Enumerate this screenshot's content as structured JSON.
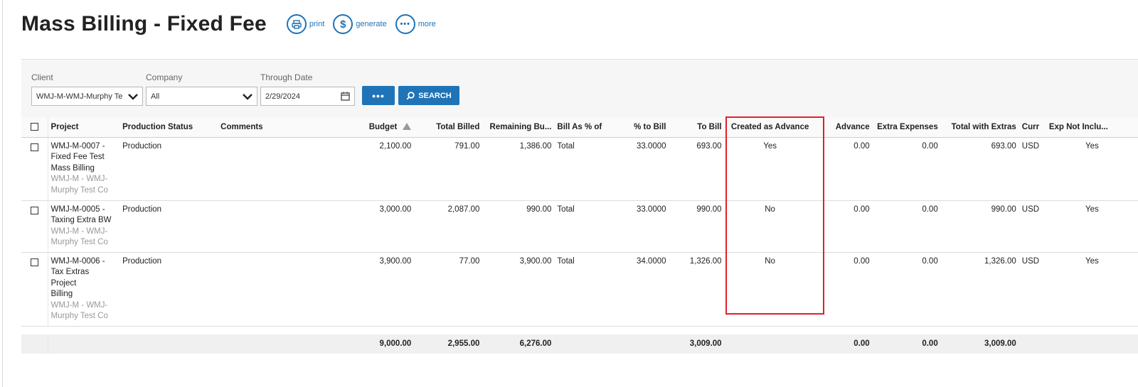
{
  "page": {
    "title": "Mass Billing - Fixed Fee",
    "actions": [
      {
        "label": "print",
        "icon": "printer-icon"
      },
      {
        "label": "generate",
        "icon": "dollar-icon"
      },
      {
        "label": "more",
        "icon": "more-dots-icon"
      }
    ]
  },
  "filters": {
    "client": {
      "label": "Client",
      "value": "WMJ-M-WMJ-Murphy Te"
    },
    "company": {
      "label": "Company",
      "value": "All"
    },
    "through_date": {
      "label": "Through Date",
      "value": "2/29/2024"
    },
    "more_button": "•••",
    "search_button": "SEARCH"
  },
  "table": {
    "headers": {
      "project": "Project",
      "production_status": "Production Status",
      "comments": "Comments",
      "budget": "Budget",
      "total_billed": "Total Billed",
      "remaining_budget": "Remaining Bu...",
      "bill_as": "Bill As % of",
      "pct_to_bill": "% to Bill",
      "to_bill": "To Bill",
      "created_as_advance": "Created as Advance",
      "advance": "Advance",
      "extra_expenses": "Extra Expenses",
      "total_with_extras": "Total with Extras",
      "curr": "Curr",
      "exp_not_included": "Exp Not Inclu..."
    },
    "rows": [
      {
        "project_lines": [
          "WMJ-M-0007 -",
          "Fixed Fee Test",
          "Mass Billing"
        ],
        "client_lines": [
          "WMJ-M - WMJ-",
          "Murphy Test Co"
        ],
        "production_status": "Production",
        "comments": "",
        "budget": "2,100.00",
        "total_billed": "791.00",
        "remaining_budget": "1,386.00",
        "bill_as": "Total",
        "pct_to_bill": "33.0000",
        "to_bill": "693.00",
        "created_as_advance": "Yes",
        "advance": "0.00",
        "extra_expenses": "0.00",
        "total_with_extras": "693.00",
        "curr": "USD",
        "exp_not_included": "Yes"
      },
      {
        "project_lines": [
          "WMJ-M-0005 -",
          "Taxing Extra BW"
        ],
        "client_lines": [
          "WMJ-M - WMJ-",
          "Murphy Test Co"
        ],
        "production_status": "Production",
        "comments": "",
        "budget": "3,000.00",
        "total_billed": "2,087.00",
        "remaining_budget": "990.00",
        "bill_as": "Total",
        "pct_to_bill": "33.0000",
        "to_bill": "990.00",
        "created_as_advance": "No",
        "advance": "0.00",
        "extra_expenses": "0.00",
        "total_with_extras": "990.00",
        "curr": "USD",
        "exp_not_included": "Yes"
      },
      {
        "project_lines": [
          "WMJ-M-0006 -",
          "Tax Extras Project",
          "Billing"
        ],
        "client_lines": [
          "WMJ-M - WMJ-",
          "Murphy Test Co"
        ],
        "production_status": "Production",
        "comments": "",
        "budget": "3,900.00",
        "total_billed": "77.00",
        "remaining_budget": "3,900.00",
        "bill_as": "Total",
        "pct_to_bill": "34.0000",
        "to_bill": "1,326.00",
        "created_as_advance": "No",
        "advance": "0.00",
        "extra_expenses": "0.00",
        "total_with_extras": "1,326.00",
        "curr": "USD",
        "exp_not_included": "Yes"
      }
    ],
    "totals": {
      "budget": "9,000.00",
      "total_billed": "2,955.00",
      "remaining_budget": "6,276.00",
      "to_bill": "3,009.00",
      "advance": "0.00",
      "extra_expenses": "0.00",
      "total_with_extras": "3,009.00"
    }
  },
  "colors": {
    "accent": "#1f73b7",
    "highlight_border": "#e0202a"
  }
}
